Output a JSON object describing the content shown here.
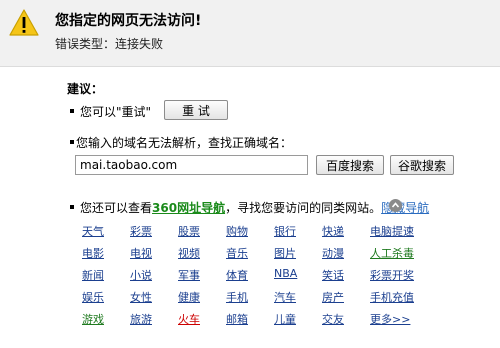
{
  "error": {
    "title": "您指定的网页无法访问!",
    "type": "错误类型：连接失败"
  },
  "suggestions": {
    "title": "建议：",
    "retry_text": "您可以\"重试\"",
    "retry_button": "重 试",
    "domain_text": "您输入的域名无法解析，查找正确域名：",
    "url_value": "mai.taobao.com",
    "baidu_button": "百度搜索",
    "google_button": "谷歌搜索",
    "nav_prefix": "您还可以查看",
    "nav_link": "360网址导航",
    "nav_suffix": "，寻找您要访问的同类网站。",
    "hide_nav": "隐藏导航"
  },
  "colors": {
    "header_bg": "#f1f1f1",
    "link_blue": "#1b3f8f",
    "link_green": "#1f7a1f",
    "link_red": "#cc0000",
    "warning_yellow": "#f5c518"
  },
  "nav_links": [
    [
      {
        "t": "天气",
        "c": "blue"
      },
      {
        "t": "彩票",
        "c": "blue"
      },
      {
        "t": "股票",
        "c": "blue"
      },
      {
        "t": "购物",
        "c": "blue"
      },
      {
        "t": "银行",
        "c": "blue"
      },
      {
        "t": "快递",
        "c": "blue"
      },
      {
        "t": "电脑提速",
        "c": "blue"
      }
    ],
    [
      {
        "t": "电影",
        "c": "blue"
      },
      {
        "t": "电视",
        "c": "blue"
      },
      {
        "t": "视频",
        "c": "blue"
      },
      {
        "t": "音乐",
        "c": "blue"
      },
      {
        "t": "图片",
        "c": "blue"
      },
      {
        "t": "动漫",
        "c": "blue"
      },
      {
        "t": "人工杀毒",
        "c": "green"
      }
    ],
    [
      {
        "t": "新闻",
        "c": "blue"
      },
      {
        "t": "小说",
        "c": "blue"
      },
      {
        "t": "军事",
        "c": "blue"
      },
      {
        "t": "体育",
        "c": "blue"
      },
      {
        "t": "NBA",
        "c": "blue"
      },
      {
        "t": "笑话",
        "c": "blue"
      },
      {
        "t": "彩票开奖",
        "c": "blue"
      }
    ],
    [
      {
        "t": "娱乐",
        "c": "blue"
      },
      {
        "t": "女性",
        "c": "blue"
      },
      {
        "t": "健康",
        "c": "blue"
      },
      {
        "t": "手机",
        "c": "blue"
      },
      {
        "t": "汽车",
        "c": "blue"
      },
      {
        "t": "房产",
        "c": "blue"
      },
      {
        "t": "手机充值",
        "c": "blue"
      }
    ],
    [
      {
        "t": "游戏",
        "c": "green"
      },
      {
        "t": "旅游",
        "c": "blue"
      },
      {
        "t": "火车",
        "c": "red"
      },
      {
        "t": "邮箱",
        "c": "blue"
      },
      {
        "t": "儿童",
        "c": "blue"
      },
      {
        "t": "交友",
        "c": "blue"
      },
      {
        "t": "更多>>",
        "c": "blue"
      }
    ]
  ]
}
